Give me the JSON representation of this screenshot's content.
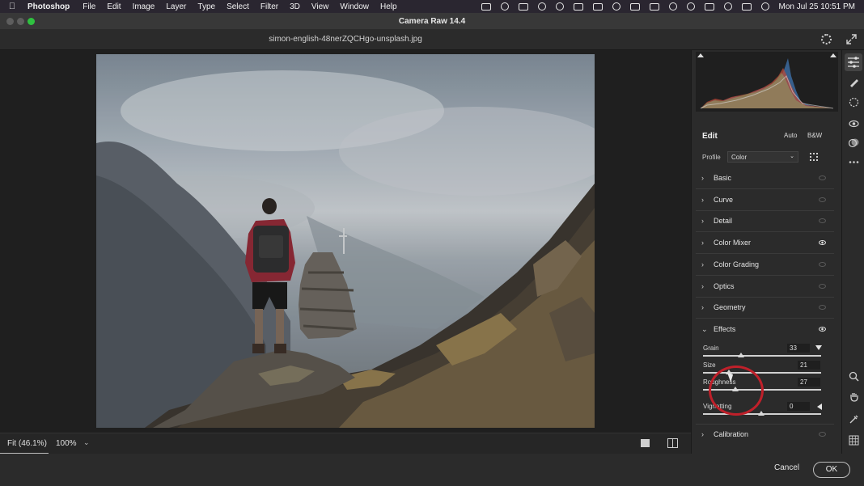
{
  "menubar": {
    "app_name": "Photoshop",
    "items": [
      "File",
      "Edit",
      "Image",
      "Layer",
      "Type",
      "Select",
      "Filter",
      "3D",
      "View",
      "Window",
      "Help"
    ],
    "clock": "Mon Jul 25  10:51 PM"
  },
  "window": {
    "title": "Camera Raw 14.4",
    "filename": "simon-english-48nerZQCHgo-unsplash.jpg"
  },
  "status": {
    "fit_label": "Fit (46.1%)",
    "zoom_label": "100%"
  },
  "panel": {
    "edit_title": "Edit",
    "auto_label": "Auto",
    "bw_label": "B&W",
    "profile_label": "Profile",
    "profile_value": "Color",
    "sections": [
      {
        "title": "Basic",
        "expanded": false,
        "visible_toggle": false
      },
      {
        "title": "Curve",
        "expanded": false,
        "visible_toggle": false
      },
      {
        "title": "Detail",
        "expanded": false,
        "visible_toggle": false
      },
      {
        "title": "Color Mixer",
        "expanded": false,
        "visible_toggle": true
      },
      {
        "title": "Color Grading",
        "expanded": false,
        "visible_toggle": false
      },
      {
        "title": "Optics",
        "expanded": false,
        "visible_toggle": false
      },
      {
        "title": "Geometry",
        "expanded": false,
        "visible_toggle": false
      },
      {
        "title": "Effects",
        "expanded": true,
        "visible_toggle": true
      },
      {
        "title": "Calibration",
        "expanded": false,
        "visible_toggle": false
      }
    ],
    "effects": {
      "grain_label": "Grain",
      "grain_value": "33",
      "size_label": "Size",
      "size_value": "21",
      "roughness_label": "Roughness",
      "roughness_value": "27",
      "vignetting_label": "Vignetting",
      "vignetting_value": "0"
    }
  },
  "buttons": {
    "cancel": "Cancel",
    "ok": "OK"
  },
  "colors": {
    "annotation_red": "#c0202a",
    "accent_green": "#2fc140"
  }
}
